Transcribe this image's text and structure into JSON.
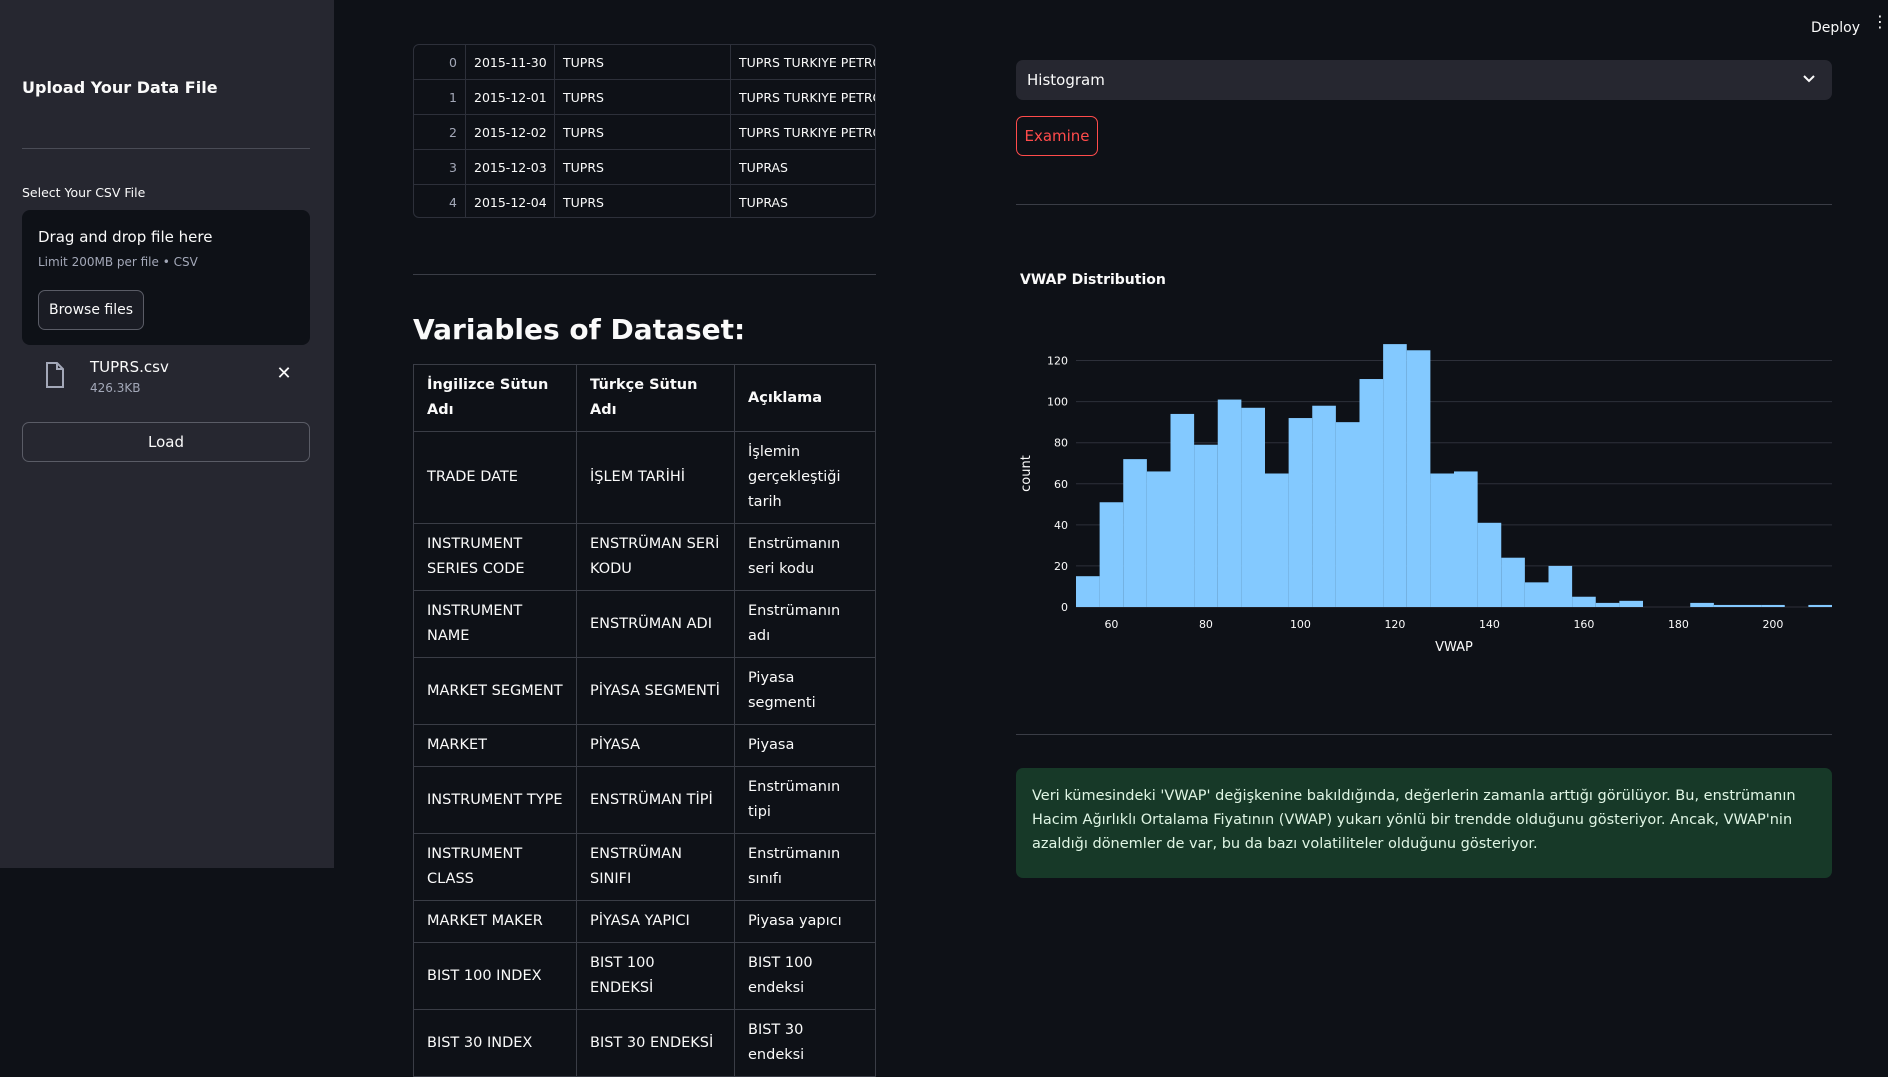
{
  "sidebar": {
    "title": "Upload Your Data File",
    "csv_label": "Select Your CSV File",
    "dropzone_title": "Drag and drop file here",
    "dropzone_limit": "Limit 200MB per file • CSV",
    "browse_label": "Browse files",
    "file_name": "TUPRS.csv",
    "file_size": "426.3KB",
    "load_label": "Load"
  },
  "header": {
    "deploy_label": "Deploy"
  },
  "top_table": {
    "rows": [
      {
        "idx": "0",
        "date": "2015-11-30",
        "code": "TUPRS",
        "name": "TUPRS TURKIYE PETROL"
      },
      {
        "idx": "1",
        "date": "2015-12-01",
        "code": "TUPRS",
        "name": "TUPRS TURKIYE PETROL"
      },
      {
        "idx": "2",
        "date": "2015-12-02",
        "code": "TUPRS",
        "name": "TUPRS TURKIYE PETROL"
      },
      {
        "idx": "3",
        "date": "2015-12-03",
        "code": "TUPRS",
        "name": "TUPRAS"
      },
      {
        "idx": "4",
        "date": "2015-12-04",
        "code": "TUPRS",
        "name": "TUPRAS"
      }
    ]
  },
  "variables": {
    "heading": "Variables of Dataset:",
    "headers": [
      "İngilizce Sütun Adı",
      "Türkçe Sütun Adı",
      "Açıklama"
    ],
    "rows": [
      [
        "TRADE DATE",
        "İŞLEM TARİHİ",
        "İşlemin gerçekleştiği tarih"
      ],
      [
        "INSTRUMENT SERIES CODE",
        "ENSTRÜMAN SERİ KODU",
        "Enstrümanın seri kodu"
      ],
      [
        "INSTRUMENT NAME",
        "ENSTRÜMAN ADI",
        "Enstrümanın adı"
      ],
      [
        "MARKET SEGMENT",
        "PİYASA SEGMENTİ",
        "Piyasa segmenti"
      ],
      [
        "MARKET",
        "PİYASA",
        "Piyasa"
      ],
      [
        "INSTRUMENT TYPE",
        "ENSTRÜMAN TİPİ",
        "Enstrümanın tipi"
      ],
      [
        "INSTRUMENT CLASS",
        "ENSTRÜMAN SINIFI",
        "Enstrümanın sınıfı"
      ],
      [
        "MARKET MAKER",
        "PİYASA YAPICI",
        "Piyasa yapıcı"
      ],
      [
        "BIST 100 INDEX",
        "BIST 100 ENDEKSİ",
        "BIST 100 endeksi"
      ],
      [
        "BIST 30 INDEX",
        "BIST 30 ENDEKSİ",
        "BIST 30 endeksi"
      ]
    ]
  },
  "controls": {
    "chart_select_value": "Histogram",
    "examine_label": "Examine"
  },
  "alert": {
    "text": "Veri kümesindeki 'VWAP' değişkenine bakıldığında, değerlerin zamanla arttığı görülüyor. Bu, enstrümanın Hacim Ağırlıklı Ortalama Fiyatının (VWAP) yukarı yönlü bir trendde olduğunu gösteriyor. Ancak, VWAP'nin azaldığı dönemler de var, bu da bazı volatiliteler olduğunu gösteriyor."
  },
  "colors": {
    "bar": "#83c9ff",
    "accent": "#ff4b4b",
    "sidebar_bg": "#262730",
    "page_bg": "#0e1117",
    "alert_bg": "#173928"
  },
  "chart_data": {
    "type": "bar",
    "title": "VWAP Distribution",
    "xlabel": "VWAP",
    "ylabel": "count",
    "xlim": [
      52.5,
      212.5
    ],
    "ylim": [
      0,
      130
    ],
    "bin_width": 5,
    "x_ticks": [
      60,
      80,
      100,
      120,
      140,
      160,
      180,
      200
    ],
    "y_ticks": [
      0,
      20,
      40,
      60,
      80,
      100,
      120
    ],
    "grid": true,
    "bins": [
      {
        "x": 55,
        "count": 15
      },
      {
        "x": 60,
        "count": 51
      },
      {
        "x": 65,
        "count": 72
      },
      {
        "x": 70,
        "count": 66
      },
      {
        "x": 75,
        "count": 94
      },
      {
        "x": 80,
        "count": 79
      },
      {
        "x": 85,
        "count": 101
      },
      {
        "x": 90,
        "count": 97
      },
      {
        "x": 95,
        "count": 65
      },
      {
        "x": 100,
        "count": 92
      },
      {
        "x": 105,
        "count": 98
      },
      {
        "x": 110,
        "count": 90
      },
      {
        "x": 115,
        "count": 111
      },
      {
        "x": 120,
        "count": 128
      },
      {
        "x": 125,
        "count": 125
      },
      {
        "x": 130,
        "count": 65
      },
      {
        "x": 135,
        "count": 66
      },
      {
        "x": 140,
        "count": 41
      },
      {
        "x": 145,
        "count": 24
      },
      {
        "x": 150,
        "count": 12
      },
      {
        "x": 155,
        "count": 20
      },
      {
        "x": 160,
        "count": 5
      },
      {
        "x": 165,
        "count": 2
      },
      {
        "x": 170,
        "count": 3
      },
      {
        "x": 175,
        "count": 0
      },
      {
        "x": 180,
        "count": 0
      },
      {
        "x": 185,
        "count": 2
      },
      {
        "x": 190,
        "count": 1
      },
      {
        "x": 195,
        "count": 1
      },
      {
        "x": 200,
        "count": 1
      },
      {
        "x": 205,
        "count": 0
      },
      {
        "x": 210,
        "count": 1
      }
    ]
  }
}
